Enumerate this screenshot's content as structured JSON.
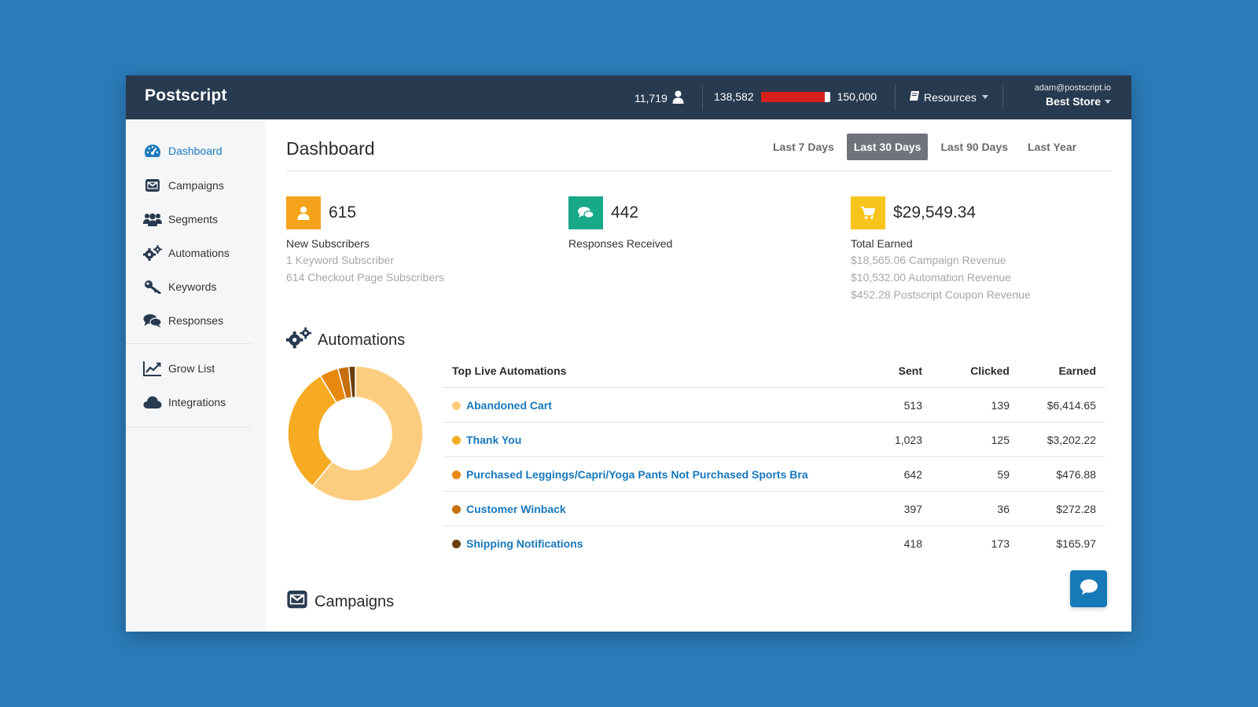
{
  "app": {
    "name": "Postscript"
  },
  "topbar": {
    "subscribers_count": "11,719",
    "credits_used": "138,582",
    "credits_limit": "150,000",
    "credits_fraction": 0.924,
    "resources_label": "Resources",
    "user_email": "adam@postscript.io",
    "store_name": "Best Store"
  },
  "sidebar": {
    "items": [
      {
        "label": "Dashboard",
        "icon": "dashboard-icon"
      },
      {
        "label": "Campaigns",
        "icon": "envelope-icon"
      },
      {
        "label": "Segments",
        "icon": "users-icon"
      },
      {
        "label": "Automations",
        "icon": "gears-icon"
      },
      {
        "label": "Keywords",
        "icon": "key-icon"
      },
      {
        "label": "Responses",
        "icon": "comments-icon"
      },
      {
        "label": "Grow List",
        "icon": "chart-line-icon"
      },
      {
        "label": "Integrations",
        "icon": "cloud-icon"
      }
    ]
  },
  "dashboard": {
    "title": "Dashboard",
    "ranges": [
      "Last 7 Days",
      "Last 30 Days",
      "Last 90 Days",
      "Last Year"
    ],
    "active_range": "Last 30 Days"
  },
  "stats": {
    "subscribers": {
      "value": "615",
      "label": "New Subscribers",
      "details": [
        "1 Keyword Subscriber",
        "614 Checkout Page Subscribers"
      ],
      "color": "#f5a31a"
    },
    "responses": {
      "value": "442",
      "label": "Responses Received",
      "color": "#17a98a"
    },
    "earned": {
      "value": "$29,549.34",
      "label": "Total Earned",
      "details": [
        "$18,565.06 Campaign Revenue",
        "$10,532.00 Automation Revenue",
        "$452.28 Postscript Coupon Revenue"
      ],
      "color": "#f7c41c"
    }
  },
  "automations": {
    "title": "Automations",
    "table_headers": {
      "name": "Top Live Automations",
      "sent": "Sent",
      "clicked": "Clicked",
      "earned": "Earned"
    },
    "rows": [
      {
        "name": "Abandoned Cart",
        "sent": "513",
        "clicked": "139",
        "earned": "$6,414.65",
        "color": "#fdcd7f"
      },
      {
        "name": "Thank You",
        "sent": "1,023",
        "clicked": "125",
        "earned": "$3,202.22",
        "color": "#f6ab23"
      },
      {
        "name": "Purchased Leggings/Capri/Yoga Pants Not Purchased Sports Bra",
        "sent": "642",
        "clicked": "59",
        "earned": "$476.88",
        "color": "#e8890f"
      },
      {
        "name": "Customer Winback",
        "sent": "397",
        "clicked": "36",
        "earned": "$272.28",
        "color": "#c66f0c"
      },
      {
        "name": "Shipping Notifications",
        "sent": "418",
        "clicked": "173",
        "earned": "$165.97",
        "color": "#6b3f0c"
      }
    ]
  },
  "campaigns": {
    "title": "Campaigns"
  },
  "colors": {
    "topbar": "#283a4f",
    "link": "#1778bc",
    "accent": "#1879b9"
  }
}
